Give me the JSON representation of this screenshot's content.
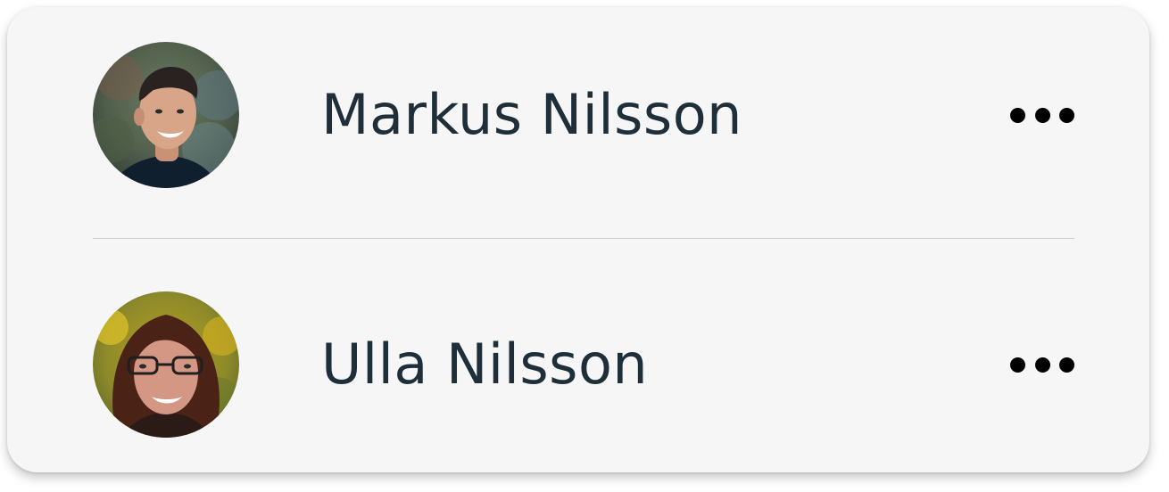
{
  "contacts": [
    {
      "name": "Markus Nilsson",
      "avatar_icon": "person-avatar-male",
      "more_icon": "more-horizontal-icon"
    },
    {
      "name": "Ulla Nilsson",
      "avatar_icon": "person-avatar-female",
      "more_icon": "more-horizontal-icon"
    }
  ],
  "colors": {
    "card_background": "#f6f6f6",
    "name_text": "#1e2f3a",
    "divider": "#cfcfcf",
    "dots": "#000000"
  }
}
